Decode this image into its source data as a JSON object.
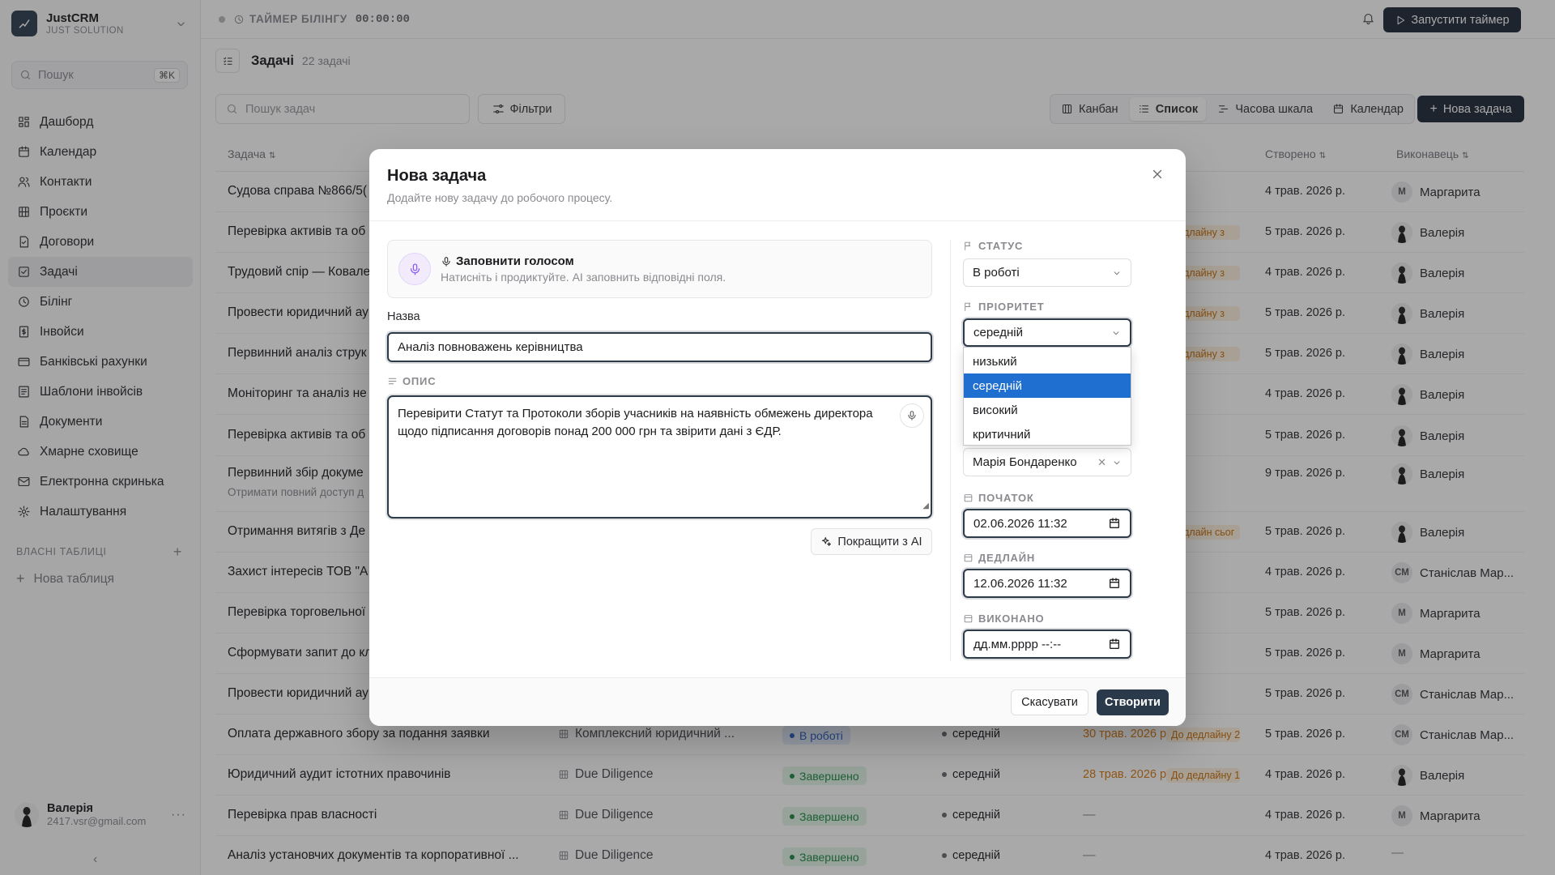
{
  "workspace": {
    "name": "JustCRM",
    "subtitle": "JUST SOLUTION"
  },
  "sidebar": {
    "search_placeholder": "Пошук",
    "search_shortcut": "⌘K",
    "items": [
      {
        "label": "Дашборд",
        "icon": "dashboard-icon"
      },
      {
        "label": "Календар",
        "icon": "calendar-icon"
      },
      {
        "label": "Контакти",
        "icon": "users-icon"
      },
      {
        "label": "Проєкти",
        "icon": "building-icon"
      },
      {
        "label": "Договори",
        "icon": "contract-icon"
      },
      {
        "label": "Задачі",
        "icon": "check-square-icon",
        "active": true
      },
      {
        "label": "Білінг",
        "icon": "clock-icon"
      },
      {
        "label": "Інвойси",
        "icon": "dollar-icon"
      },
      {
        "label": "Банківські рахунки",
        "icon": "bank-icon"
      },
      {
        "label": "Шаблони інвойсів",
        "icon": "template-icon"
      },
      {
        "label": "Документи",
        "icon": "document-icon"
      },
      {
        "label": "Хмарне сховище",
        "icon": "cloud-icon"
      },
      {
        "label": "Електронна скринька",
        "icon": "mail-icon"
      },
      {
        "label": "Налаштування",
        "icon": "gear-icon"
      }
    ],
    "custom_tables_label": "ВЛАСНІ ТАБЛИЦІ",
    "new_table_label": "Нова таблиця",
    "user": {
      "name": "Валерія",
      "email": "2417.vsr@gmail.com"
    }
  },
  "topbar": {
    "timer_label": "ТАЙМЕР БІЛІНГУ",
    "timer_value": "00:00:00",
    "start_timer": "Запустити таймер"
  },
  "page": {
    "title": "Задачі",
    "count": "22 задачі"
  },
  "toolbar": {
    "search_placeholder": "Пошук задач",
    "filters": "Фільтри",
    "views": [
      {
        "label": "Канбан",
        "icon": "kanban-icon"
      },
      {
        "label": "Список",
        "icon": "list-icon",
        "active": true
      },
      {
        "label": "Часова шкала",
        "icon": "timeline-icon"
      },
      {
        "label": "Календар",
        "icon": "calendar-icon"
      }
    ],
    "new_task": "Нова задача"
  },
  "table": {
    "headers": {
      "task": "Задача",
      "created": "Створено",
      "executor": "Виконавець"
    },
    "rows": [
      {
        "name": "Судова справа №866/5(",
        "created": "4 трав. 2026 р.",
        "exec_initials": "М",
        "exec": "Маргарита"
      },
      {
        "name": "Перевірка активів та об",
        "deadline_badge": "Дедлайну з",
        "created": "5 трав. 2026 р.",
        "exec_photo": true,
        "exec": "Валерія"
      },
      {
        "name": "Трудовий спір — Ковале",
        "deadline_badge": "Дедлайну з",
        "created": "4 трав. 2026 р.",
        "exec_photo": true,
        "exec": "Валерія"
      },
      {
        "name": "Провести юридичний ау",
        "deadline_badge": "Дедлайну з",
        "created": "5 трав. 2026 р.",
        "exec_photo": true,
        "exec": "Валерія"
      },
      {
        "name": "Первинний аналіз струк",
        "deadline_badge": "Дедлайну з",
        "created": "5 трав. 2026 р.",
        "exec_photo": true,
        "exec": "Валерія"
      },
      {
        "name": "Моніторинг та аналіз не",
        "created": "4 трав. 2026 р.",
        "exec_photo": true,
        "exec": "Валерія"
      },
      {
        "name": "Перевірка активів та об",
        "created": "5 трав. 2026 р.",
        "exec_photo": true,
        "exec": "Валерія"
      },
      {
        "name": "Первинний збір докуме",
        "sub": "Отримати повний доступ д",
        "created": "9 трав. 2026 р.",
        "exec_photo": true,
        "exec": "Валерія"
      },
      {
        "name": "Отримання витягів з Де",
        "deadline_badge": "Дедлайн сьог",
        "created": "5 трав. 2026 р.",
        "exec_photo": true,
        "exec": "Валерія"
      },
      {
        "name": "Захист інтересів ТОВ \"А",
        "created": "4 трав. 2026 р.",
        "exec_initials": "СМ",
        "exec": "Станіслав Мар..."
      },
      {
        "name": "Перевірка торговельної",
        "created": "5 трав. 2026 р.",
        "exec_initials": "М",
        "exec": "Маргарита"
      },
      {
        "name": "Сформувати запит до кл",
        "created": "5 трав. 2026 р.",
        "exec_initials": "М",
        "exec": "Маргарита"
      },
      {
        "name": "Провести юридичний ау",
        "created": "5 трав. 2026 р.",
        "exec_initials": "СМ",
        "exec": "Станіслав Мар..."
      },
      {
        "name": "Оплата державного збору за подання заявки",
        "project": "Комплексний юридичний ...",
        "status": "В роботі",
        "status_kind": "work",
        "priority": "середній",
        "deadline": "30 трав. 2026 р.",
        "deadline_badge": "До дедлайну 2",
        "created": "5 трав. 2026 р.",
        "exec_initials": "СМ",
        "exec": "Станіслав Мар..."
      },
      {
        "name": "Юридичний аудит істотних правочинів",
        "project": "Due Diligence",
        "status": "Завершено",
        "status_kind": "done",
        "priority": "середній",
        "deadline": "28 трав. 2026 р.",
        "deadline_badge": "До дедлайну 1",
        "created": "4 трав. 2026 р.",
        "exec_photo": true,
        "exec": "Валерія"
      },
      {
        "name": "Перевірка прав власності",
        "project": "Due Diligence",
        "status": "Завершено",
        "status_kind": "done",
        "priority": "середній",
        "deadline": "—",
        "created": "4 трав. 2026 р.",
        "exec_initials": "М",
        "exec": "Маргарита"
      },
      {
        "name": "Аналіз установчих документів та корпоративної ...",
        "project": "Due Diligence",
        "status": "Завершено",
        "status_kind": "done",
        "priority": "середній",
        "deadline": "—",
        "created": "4 трав. 2026 р.",
        "exec": "—"
      }
    ]
  },
  "modal": {
    "title": "Нова задача",
    "description": "Додайте нову задачу до робочого процесу.",
    "voice_title": "Заповнити голосом",
    "voice_hint": "Натисніть і продиктуйте. AI заповнить відповідні поля.",
    "name_label": "Назва",
    "name_value": "Аналіз повноважень керівництва",
    "desc_label": "ОПИС",
    "desc_value": "Перевірити Статут та Протоколи зборів учасників на наявність обмежень директора щодо підписання договорів понад 200 000 грн та звірити дані з ЄДР.",
    "ai_button": "Покращити з AI",
    "status_label": "СТАТУС",
    "status_value": "В роботі",
    "priority_label": "ПРІОРИТЕТ",
    "priority_value": "середній",
    "priority_options": [
      "низький",
      "середній",
      "високий",
      "критичний"
    ],
    "assignee_value": "Марія Бондаренко",
    "start_label": "ПОЧАТОК",
    "start_value": "02.06.2026 11:32",
    "deadline_label": "ДЕДЛАЙН",
    "deadline_value": "12.06.2026 11:32",
    "done_label": "ВИКОНАНО",
    "done_placeholder": "дд.мм.рррр --:--",
    "cancel": "Скасувати",
    "create": "Створити"
  }
}
